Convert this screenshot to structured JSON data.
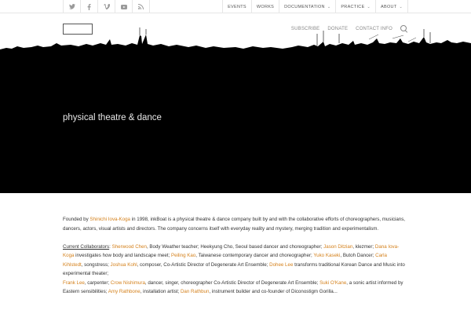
{
  "social": [
    {
      "icon": "twitter-icon",
      "glyph": "𝕥"
    },
    {
      "icon": "facebook-icon",
      "glyph": "f"
    },
    {
      "icon": "vimeo-icon",
      "glyph": "v"
    },
    {
      "icon": "youtube-icon",
      "glyph": "▶"
    },
    {
      "icon": "rss-icon",
      "glyph": "◔"
    }
  ],
  "topnav": {
    "events": "EVENTS",
    "works": "WORKS",
    "documentation": "DOCUMENTATION",
    "practice": "PRACTICE",
    "about": "ABOUT"
  },
  "mainnav": {
    "subscribe": "SUBSCRIBE",
    "donate": "DONATE",
    "contact": "CONTACT INFO"
  },
  "hero": {
    "title": "physical theatre & dance"
  },
  "content": {
    "p1_a": "Founded by ",
    "p1_link": "Shinichi Iova-Koga",
    "p1_b": " in 1998, inkBoat is a physical theatre & dance company built by and with the collaborative efforts of choreographers, musicians, dancers, actors, visual artists and directors. The company concerns itself with everyday reality and mystery, merging tradition and experimentalism.",
    "collab_label": "Current Collaborators",
    "c1": "Sherwood Chen",
    "c1_t": ", Body Weather teacher; Heekyung Cho, Seoul based dancer and choreographer; ",
    "c2": "Jason Ditzian",
    "c2_t": ", klezmer; ",
    "c3": "Dana Iova-Koga",
    "c3_t": " investigates how body and landscape meet; ",
    "c4": "Peiling Kao",
    "c4_t": ", Taiwanese contemporary dancer and choreographer; ",
    "c5": "Yuko Kaseki",
    "c5_t": ", Butoh Dancer; ",
    "c6": "Carla Kihlstedt",
    "c6_t": ", songstress; ",
    "c7": "Joshua Kohl",
    "c7_t": ", composer, Co-Artistic Director of Degenerate Art Ensemble;  ",
    "c8": "Dohee Lee",
    "c8_t": " transforms traditional Korean Dance and Music into experimental theater;",
    "c9": "Frank Lee",
    "c9_t": ", carpenter; ",
    "c10": "Crow Nishimura",
    "c10_t": ", dancer, singer, choreographer Co-Artistic Director of Degenerate Art Ensemble; ",
    "c11": "Suki O'Kane",
    "c11_t": ", a sonic artist informed by Eastern sensibilities; ",
    "c12": "Amy Rathbone",
    "c12_t": ", installation artist; ",
    "c13": "Dan Rathbun",
    "c13_t": ", instrument builder and co-founder of Diconostigm Gorilla..."
  }
}
